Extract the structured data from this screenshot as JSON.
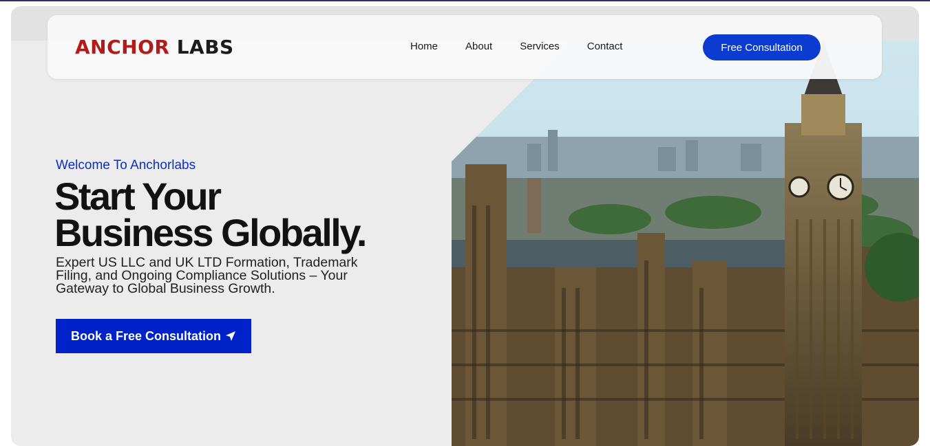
{
  "brand": {
    "logo_part1": "ANCHOR",
    "logo_part2": " LABS",
    "logo_color_primary": "#b31b1b",
    "logo_color_secondary": "#1b1b1b"
  },
  "nav": {
    "links": [
      "Home",
      "About",
      "Services",
      "Contact"
    ],
    "cta_label": "Free Consultation"
  },
  "hero": {
    "eyebrow": "Welcome To Anchorlabs",
    "headline_line1": "Start Your",
    "headline_line2": "Business Globally.",
    "description": "Expert US LLC and UK LTD Formation, Trademark Filing, and Ongoing Compliance Solutions – Your Gateway to Global Business Growth.",
    "cta_label": "Book a Free Consultation",
    "cta_icon": "paper-plane-icon",
    "image": "london-skyline-big-ben-photo"
  },
  "colors": {
    "accent": "#0b3ccf",
    "cta_hero": "#0022c9",
    "eyebrow": "#0b2fc0"
  }
}
